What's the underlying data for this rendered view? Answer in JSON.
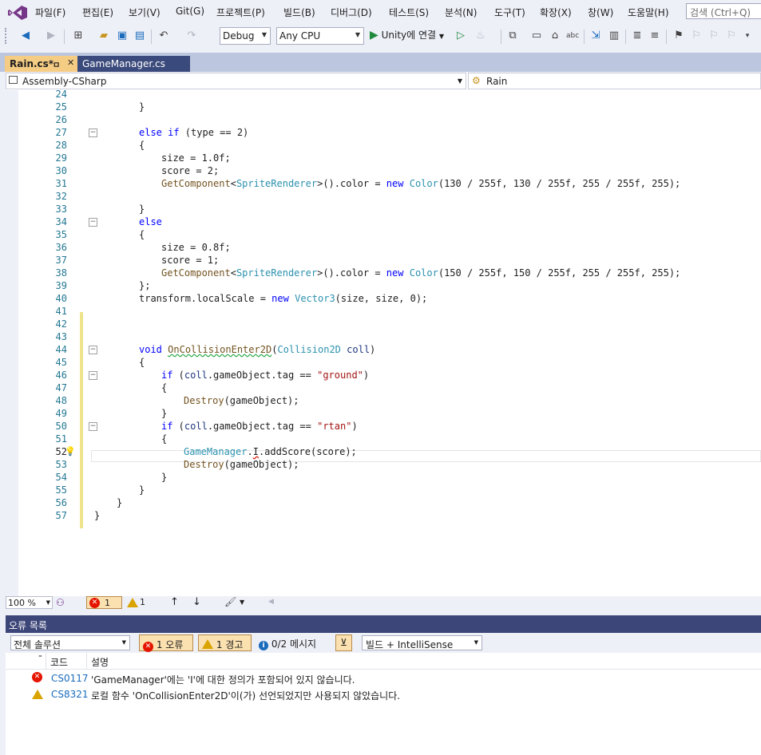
{
  "menu": {
    "items": [
      "파일(F)",
      "편집(E)",
      "보기(V)",
      "Git(G)",
      "프로젝트(P)",
      "빌드(B)",
      "디버그(D)",
      "테스트(S)",
      "분석(N)",
      "도구(T)",
      "확장(X)",
      "창(W)",
      "도움말(H)"
    ],
    "search_placeholder": "검색 (Ctrl+Q)"
  },
  "toolbar": {
    "config": "Debug",
    "platform": "Any CPU",
    "run_label": "Unity에 연결"
  },
  "tabs": [
    {
      "label": "Rain.cs*",
      "pin": "ㅁ",
      "close": "✕"
    },
    {
      "label": "GameManager.cs"
    }
  ],
  "navbar": {
    "project": "Assembly-CSharp",
    "class": "Rain"
  },
  "code": {
    "lines": [
      {
        "n": "24",
        "indent": 0,
        "tokens": [
          [
            "",
            "                                                                                              "
          ]
        ]
      },
      {
        "n": "25",
        "indent": 2,
        "tokens": [
          [
            "",
            "}"
          ]
        ]
      },
      {
        "n": "26",
        "indent": 0,
        "tokens": []
      },
      {
        "n": "27",
        "indent": 2,
        "tokens": [
          [
            "kw",
            "else if"
          ],
          [
            "",
            " (type == 2)"
          ]
        ],
        "fold": true
      },
      {
        "n": "28",
        "indent": 2,
        "tokens": [
          [
            "",
            "{"
          ]
        ]
      },
      {
        "n": "29",
        "indent": 3,
        "tokens": [
          [
            "",
            "size = 1.0f;"
          ]
        ]
      },
      {
        "n": "30",
        "indent": 3,
        "tokens": [
          [
            "",
            "score = 2;"
          ]
        ]
      },
      {
        "n": "31",
        "indent": 3,
        "tokens": [
          [
            "mt",
            "GetComponent"
          ],
          [
            "",
            "<"
          ],
          [
            "ty",
            "SpriteRenderer"
          ],
          [
            "",
            ">().color = "
          ],
          [
            "kw",
            "new"
          ],
          [
            "",
            " "
          ],
          [
            "ty",
            "Color"
          ],
          [
            "",
            "(130 / 255f, 130 / 255f, 255 / 255f, 255);"
          ]
        ]
      },
      {
        "n": "32",
        "indent": 0,
        "tokens": []
      },
      {
        "n": "33",
        "indent": 2,
        "tokens": [
          [
            "",
            "}"
          ]
        ]
      },
      {
        "n": "34",
        "indent": 2,
        "tokens": [
          [
            "kw",
            "else"
          ]
        ],
        "fold": true
      },
      {
        "n": "35",
        "indent": 2,
        "tokens": [
          [
            "",
            "{"
          ]
        ]
      },
      {
        "n": "36",
        "indent": 3,
        "tokens": [
          [
            "",
            "size = 0.8f;"
          ]
        ]
      },
      {
        "n": "37",
        "indent": 3,
        "tokens": [
          [
            "",
            "score = 1;"
          ]
        ]
      },
      {
        "n": "38",
        "indent": 3,
        "tokens": [
          [
            "mt",
            "GetComponent"
          ],
          [
            "",
            "<"
          ],
          [
            "ty",
            "SpriteRenderer"
          ],
          [
            "",
            ">().color = "
          ],
          [
            "kw",
            "new"
          ],
          [
            "",
            " "
          ],
          [
            "ty",
            "Color"
          ],
          [
            "",
            "(150 / 255f, 150 / 255f, 255 / 255f, 255);"
          ]
        ]
      },
      {
        "n": "39",
        "indent": 2,
        "tokens": [
          [
            "",
            "};"
          ]
        ]
      },
      {
        "n": "40",
        "indent": 2,
        "tokens": [
          [
            "",
            "transform.localScale = "
          ],
          [
            "kw",
            "new"
          ],
          [
            "",
            " "
          ],
          [
            "ty",
            "Vector3"
          ],
          [
            "",
            "(size, size, 0);"
          ]
        ]
      },
      {
        "n": "41",
        "indent": 0,
        "tokens": []
      },
      {
        "n": "42",
        "indent": 0,
        "tokens": []
      },
      {
        "n": "43",
        "indent": 0,
        "tokens": []
      },
      {
        "n": "44",
        "indent": 2,
        "tokens": [
          [
            "kw",
            "void"
          ],
          [
            "",
            " "
          ],
          [
            "mt squig-g",
            "OnCollisionEnter2D"
          ],
          [
            "",
            "("
          ],
          [
            "ty",
            "Collision2D"
          ],
          [
            "",
            " "
          ],
          [
            "pl",
            "coll"
          ],
          [
            "",
            ")"
          ]
        ],
        "fold": true
      },
      {
        "n": "45",
        "indent": 2,
        "tokens": [
          [
            "",
            "{"
          ]
        ]
      },
      {
        "n": "46",
        "indent": 3,
        "tokens": [
          [
            "kw",
            "if"
          ],
          [
            "",
            " ("
          ],
          [
            "pl",
            "coll"
          ],
          [
            "",
            ".gameObject.tag == "
          ],
          [
            "st",
            "\"ground\""
          ],
          [
            "",
            ")"
          ]
        ],
        "fold": true
      },
      {
        "n": "47",
        "indent": 3,
        "tokens": [
          [
            "",
            "{"
          ]
        ]
      },
      {
        "n": "48",
        "indent": 4,
        "tokens": [
          [
            "mt",
            "Destroy"
          ],
          [
            "",
            "(gameObject);"
          ]
        ]
      },
      {
        "n": "49",
        "indent": 3,
        "tokens": [
          [
            "",
            "}"
          ]
        ]
      },
      {
        "n": "50",
        "indent": 3,
        "tokens": [
          [
            "kw",
            "if"
          ],
          [
            "",
            " ("
          ],
          [
            "pl",
            "coll"
          ],
          [
            "",
            ".gameObject.tag == "
          ],
          [
            "st",
            "\"rtan\""
          ],
          [
            "",
            ")"
          ]
        ],
        "fold": true
      },
      {
        "n": "51",
        "indent": 3,
        "tokens": [
          [
            "",
            "{"
          ]
        ]
      },
      {
        "n": "52",
        "indent": 4,
        "tokens": [
          [
            "ty",
            "GameManager"
          ],
          [
            "",
            "."
          ],
          [
            "squig-r",
            "I"
          ],
          [
            "",
            ".addScore(score);"
          ]
        ],
        "current": true
      },
      {
        "n": "53",
        "indent": 4,
        "tokens": [
          [
            "mt",
            "Destroy"
          ],
          [
            "",
            "(gameObject);"
          ]
        ]
      },
      {
        "n": "54",
        "indent": 3,
        "tokens": [
          [
            "",
            "}"
          ]
        ]
      },
      {
        "n": "55",
        "indent": 2,
        "tokens": [
          [
            "",
            "}"
          ]
        ]
      },
      {
        "n": "56",
        "indent": 1,
        "tokens": [
          [
            "",
            "}"
          ]
        ]
      },
      {
        "n": "57",
        "indent": 0,
        "tokens": [
          [
            "",
            "}"
          ]
        ]
      }
    ]
  },
  "editor_status": {
    "zoom": "100 %",
    "errors": "1",
    "warnings": "1"
  },
  "error_list": {
    "title": "오류 목록",
    "scope": "전체 솔루션",
    "error_filter": "1 오류",
    "warning_filter": "1 경고",
    "message_filter": "0/2 메시지",
    "source": "빌드 + IntelliSense",
    "columns": {
      "code": "코드",
      "description": "설명"
    },
    "rows": [
      {
        "severity": "error",
        "code": "CS0117",
        "description": "'GameManager'에는 'I'에 대한 정의가 포함되어 있지 않습니다."
      },
      {
        "severity": "warning",
        "code": "CS8321",
        "description": "로컬 함수 'OnCollisionEnter2D'이(가) 선언되었지만 사용되지 않았습니다."
      }
    ]
  },
  "colors": {
    "accent_tab": "#f5cc84",
    "inactive_tab": "#3b4a7c",
    "error_red": "#e51400",
    "warning_yellow": "#d9a300",
    "link_blue": "#1a6bbb"
  }
}
